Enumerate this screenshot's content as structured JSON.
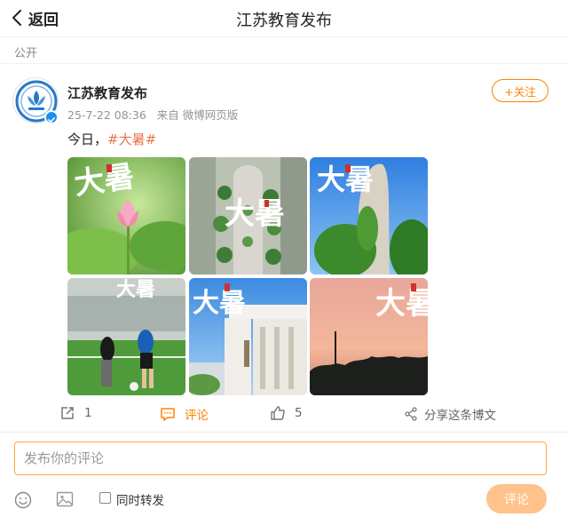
{
  "header": {
    "back_label": "返回",
    "title": "江苏教育发布"
  },
  "visibility": "公开",
  "post": {
    "author": "江苏教育发布",
    "time": "25-7-22 08:36",
    "source": "来自 微博网页版",
    "follow_label": "+关注",
    "text_prefix": "今日，",
    "hashtag": "#大暑#",
    "images": [
      {
        "name": "lotus-photo",
        "text": "大暑"
      },
      {
        "name": "campus-aerial-photo",
        "text": "大暑"
      },
      {
        "name": "rock-vines-photo",
        "text": "大暑"
      },
      {
        "name": "football-photo",
        "text": "大暑"
      },
      {
        "name": "building-photo",
        "text": "大暑"
      },
      {
        "name": "sunset-photo",
        "text": "大暑"
      }
    ]
  },
  "actions": {
    "repost_count": "1",
    "comment_label": "评论",
    "like_count": "5",
    "share_label": "分享这条博文"
  },
  "comment_box": {
    "placeholder": "发布你的评论",
    "repost_label": "同时转发",
    "submit_label": "评论"
  },
  "colors": {
    "accent": "#ff8200",
    "hashtag": "#eb7350",
    "submit_disabled": "#ffc28a",
    "verified": "#1c8ff0"
  }
}
